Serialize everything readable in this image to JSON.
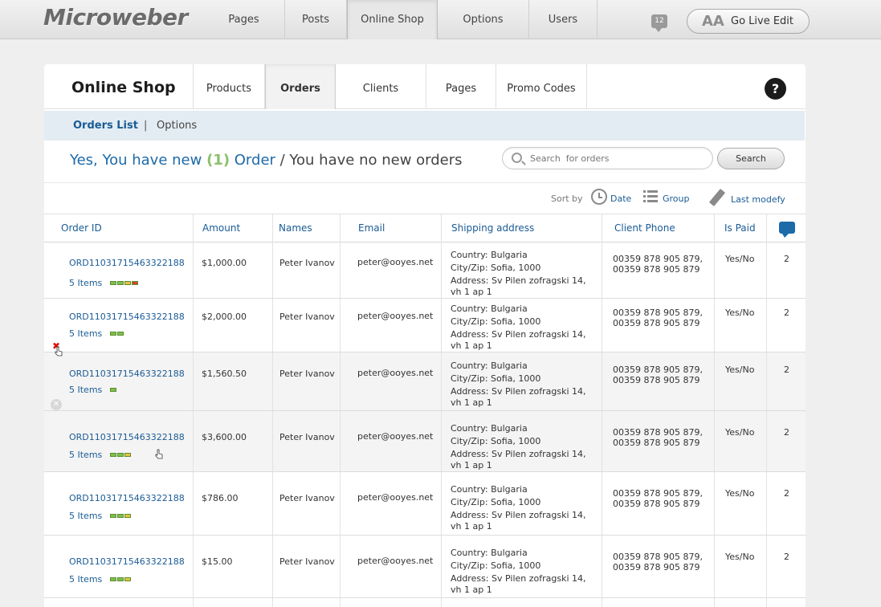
{
  "app": {
    "logo": "Microweber"
  },
  "topnav": [
    {
      "label": "Pages",
      "active": false
    },
    {
      "label": "Posts",
      "active": false
    },
    {
      "label": "Online Shop",
      "active": true
    },
    {
      "label": "Options",
      "active": false
    },
    {
      "label": "Users",
      "active": false
    }
  ],
  "notifications": {
    "count": "12",
    "icon": "chat-bubble-icon"
  },
  "golive": {
    "label": "Go Live Edit",
    "icon_text": "AA"
  },
  "panel": {
    "title": "Online Shop",
    "tabs": [
      {
        "label": "Products",
        "active": false
      },
      {
        "label": "Orders",
        "active": true
      },
      {
        "label": "Clients",
        "active": false
      },
      {
        "label": "Pages",
        "active": false
      },
      {
        "label": "Promo Codes",
        "active": false
      }
    ],
    "help_label": "?"
  },
  "subnav": {
    "orders_list": "Orders List",
    "separator": "|",
    "options": "Options"
  },
  "status": {
    "part1": "Yes, You have new ",
    "count": "(1)",
    "part2": " Order",
    "part3": " / You have no new orders"
  },
  "search": {
    "placeholder": "Search  for orders",
    "button": "Search"
  },
  "sort": {
    "label": "Sort by",
    "date": "Date",
    "group": "Group",
    "last_modified": "Last modefy"
  },
  "table": {
    "columns": [
      "Order ID",
      "Amount",
      "Names",
      "Email",
      "Shipping address",
      "Client Phone",
      "Is Paid"
    ],
    "rows": [
      {
        "id": "ORD11031715463322188",
        "items": "5 Items",
        "amount": "$1,000.00",
        "name": "Peter Ivanov",
        "email": "peter@ooyes.net",
        "addr1": "Country: Bulgaria",
        "addr2": "City/Zip: Sofia, 1000",
        "addr3": "Address:  Sv Pilen zofragski 14,",
        "addr4": "vh 1 ap 1",
        "phone1": "00359 878 905 879,",
        "phone2": "00359 878 905 879",
        "paid": "Yes/No",
        "comments": "2",
        "bars": [
          "#7cc04a",
          "#7cc04a",
          "#e6c43a",
          "#d9432e"
        ]
      },
      {
        "id": "ORD11031715463322188",
        "items": "5 Items",
        "amount": "$2,000.00",
        "name": "Peter Ivanov",
        "email": "peter@ooyes.net",
        "addr1": "Country: Bulgaria",
        "addr2": "City/Zip: Sofia, 1000",
        "addr3": "Address:  Sv Pilen zofragski 14,",
        "addr4": "vh 1 ap 1",
        "phone1": "00359 878 905 879,",
        "phone2": "00359 878 905 879",
        "paid": "Yes/No",
        "comments": "2",
        "bars": [
          "#7cc04a",
          "#7cc04a"
        ]
      },
      {
        "id": "ORD11031715463322188",
        "items": "5 Items",
        "amount": "$1,560.50",
        "name": "Peter Ivanov",
        "email": "peter@ooyes.net",
        "addr1": "Country: Bulgaria",
        "addr2": "City/Zip: Sofia, 1000",
        "addr3": "Address:  Sv Pilen zofragski 14,",
        "addr4": "vh 1 ap 1",
        "phone1": "00359 878 905 879,",
        "phone2": "00359 878 905 879",
        "paid": "Yes/No",
        "comments": "2",
        "bars": [
          "#7cc04a"
        ]
      },
      {
        "id": "ORD11031715463322188",
        "items": "5 Items",
        "amount": "$3,600.00",
        "name": "Peter Ivanov",
        "email": "peter@ooyes.net",
        "addr1": "Country: Bulgaria",
        "addr2": "City/Zip: Sofia, 1000",
        "addr3": "Address:  Sv Pilen zofragski 14,",
        "addr4": "vh 1 ap 1",
        "phone1": "00359 878 905 879,",
        "phone2": "00359 878 905 879",
        "paid": "Yes/No",
        "comments": "2",
        "bars": [
          "#7cc04a",
          "#7cc04a",
          "#e6c43a"
        ]
      },
      {
        "id": "ORD11031715463322188",
        "items": "5 Items",
        "amount": "$786.00",
        "name": "Peter Ivanov",
        "email": "peter@ooyes.net",
        "addr1": "Country: Bulgaria",
        "addr2": "City/Zip: Sofia, 1000",
        "addr3": "Address:  Sv Pilen zofragski 14,",
        "addr4": "vh 1 ap 1",
        "phone1": "00359 878 905 879,",
        "phone2": "00359 878 905 879",
        "paid": "Yes/No",
        "comments": "2",
        "bars": [
          "#7cc04a",
          "#7cc04a",
          "#e6c43a"
        ]
      },
      {
        "id": "ORD11031715463322188",
        "items": "5 Items",
        "amount": "$15.00",
        "name": "Peter Ivanov",
        "email": "peter@ooyes.net",
        "addr1": "Country: Bulgaria",
        "addr2": "City/Zip: Sofia, 1000",
        "addr3": "Address:  Sv Pilen zofragski 14,",
        "addr4": "vh 1 ap 1",
        "phone1": "00359 878 905 879,",
        "phone2": "00359 878 905 879",
        "paid": "Yes/No",
        "comments": "2",
        "bars": [
          "#7cc04a",
          "#7cc04a",
          "#e6c43a"
        ]
      }
    ]
  },
  "colors": {
    "link": "#1a5b94",
    "accent_green": "#8cbf6a",
    "subbar_bg": "#e3ecf3"
  }
}
